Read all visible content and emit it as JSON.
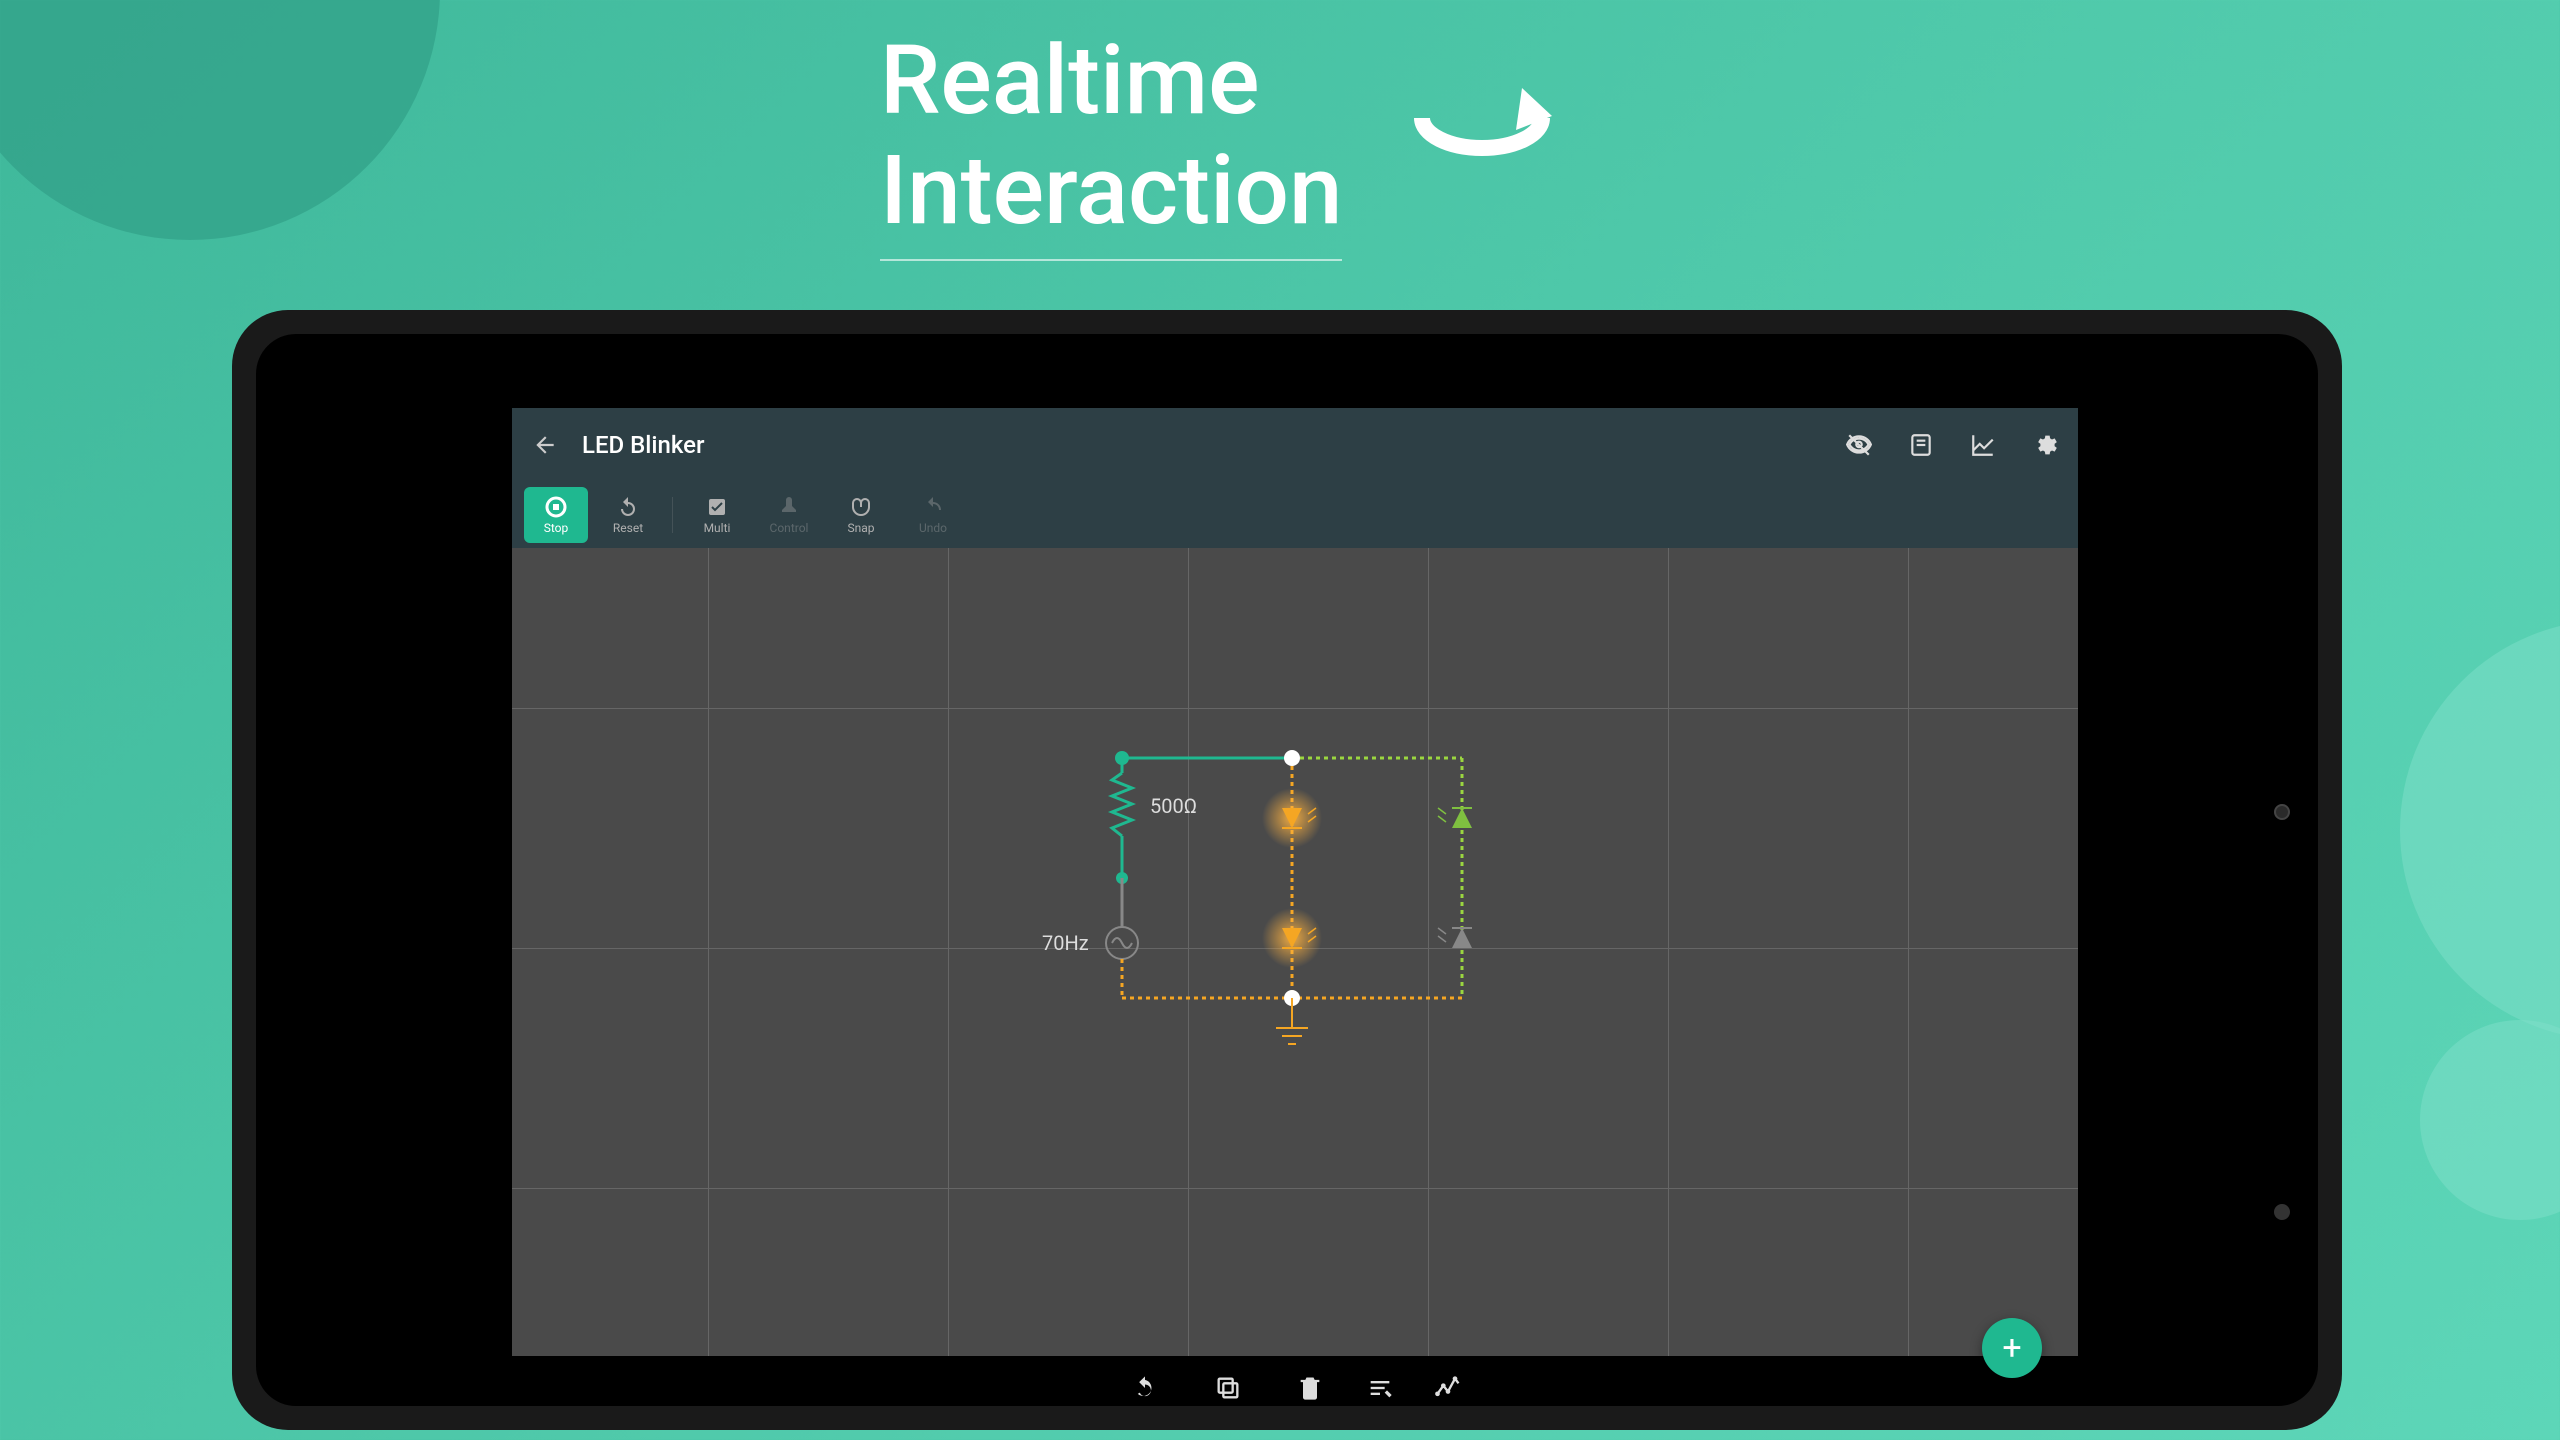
{
  "headline": {
    "line1": "Realtime",
    "line2": "Interaction"
  },
  "app": {
    "title": "LED Blinker",
    "titlebar_icons": [
      {
        "name": "visibility-off-icon"
      },
      {
        "name": "save-icon"
      },
      {
        "name": "graph-icon"
      },
      {
        "name": "settings-icon"
      }
    ],
    "toolbar": [
      {
        "name": "stop",
        "label": "Stop",
        "active": true
      },
      {
        "name": "reset",
        "label": "Reset"
      },
      {
        "sep": true
      },
      {
        "name": "multi",
        "label": "Multi"
      },
      {
        "name": "control",
        "label": "Control",
        "disabled": true
      },
      {
        "name": "snap",
        "label": "Snap"
      },
      {
        "name": "undo",
        "label": "Undo",
        "disabled": true
      }
    ],
    "bottombar": [
      {
        "name": "rotate",
        "label": "Rotate"
      },
      {
        "name": "duplicate",
        "label": "Duplicate"
      },
      {
        "name": "delete",
        "label": "Delete"
      },
      {
        "name": "edit",
        "label": "Edit"
      },
      {
        "name": "plot",
        "label": "Plot"
      }
    ],
    "fab_label": "+",
    "circuit": {
      "resistor_label": "500Ω",
      "source_label": "70Hz"
    }
  },
  "colors": {
    "accent": "#1fb890",
    "wire_active": "#f5a623",
    "wire_teal": "#1fb890",
    "led_glow": "#ffb340"
  }
}
